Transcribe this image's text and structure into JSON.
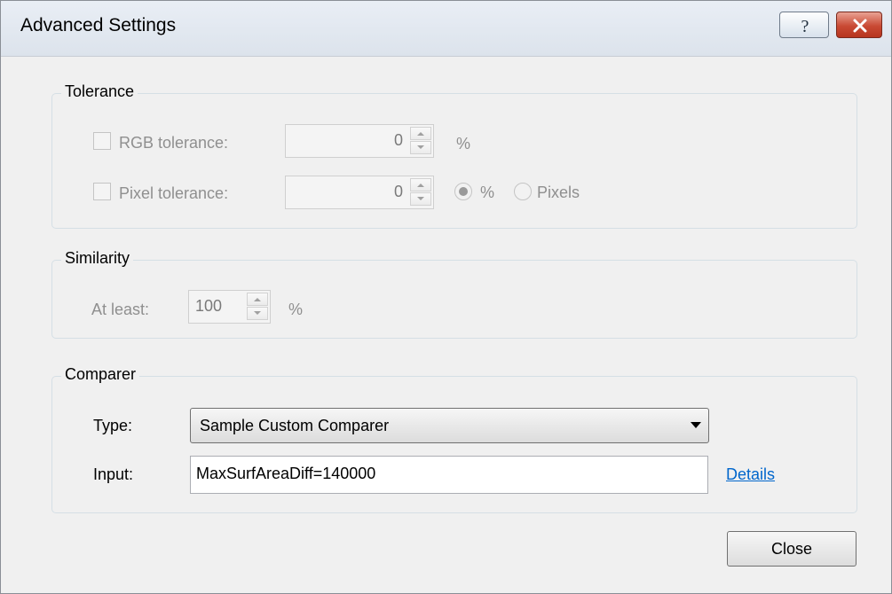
{
  "window": {
    "title": "Advanced Settings"
  },
  "title_buttons": {
    "help": "question-mark",
    "close": "x"
  },
  "tolerance": {
    "legend": "Tolerance",
    "rgb_label": "RGB tolerance:",
    "rgb_value": "0",
    "rgb_unit": "%",
    "pixel_label": "Pixel tolerance:",
    "pixel_value": "0",
    "unit_percent_label": "%",
    "unit_pixels_label": "Pixels",
    "selected_unit": "%"
  },
  "similarity": {
    "legend": "Similarity",
    "at_least_label": "At least:",
    "value": "100",
    "unit": "%"
  },
  "comparer": {
    "legend": "Comparer",
    "type_label": "Type:",
    "type_value": "Sample Custom Comparer",
    "input_label": "Input:",
    "input_value": "MaxSurfAreaDiff=140000",
    "details_link": "Details"
  },
  "footer": {
    "close_label": "Close"
  },
  "colors": {
    "link": "#0066cc",
    "close_button": "#c94a34",
    "disabled_text": "#8f8f8f"
  }
}
